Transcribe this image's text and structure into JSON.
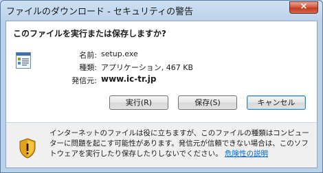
{
  "window": {
    "title": "ファイルのダウンロード - セキュリティの警告",
    "close_symbol": "×"
  },
  "dialog": {
    "question": "このファイルを実行または保存しますか?"
  },
  "file_info": {
    "icon": "application-window-icon",
    "name_label": "名前:",
    "name_value": "setup.exe",
    "type_label": "種類:",
    "type_value": "アプリケーション, 467 KB",
    "from_label": "発信元:",
    "from_value": "www.ic-tr.jp"
  },
  "buttons": {
    "run": "実行(R)",
    "save": "保存(S)",
    "cancel": "キャンセル"
  },
  "warning": {
    "icon": "shield-warning-icon",
    "text": "インターネットのファイルは役に立ちますが、このファイルの種類はコンピューターに問題を起こす可能性があります。発信元が信頼できない場合は、このソフトウェアを実行したり保存したりしないでください。",
    "link": "危険性の説明"
  }
}
